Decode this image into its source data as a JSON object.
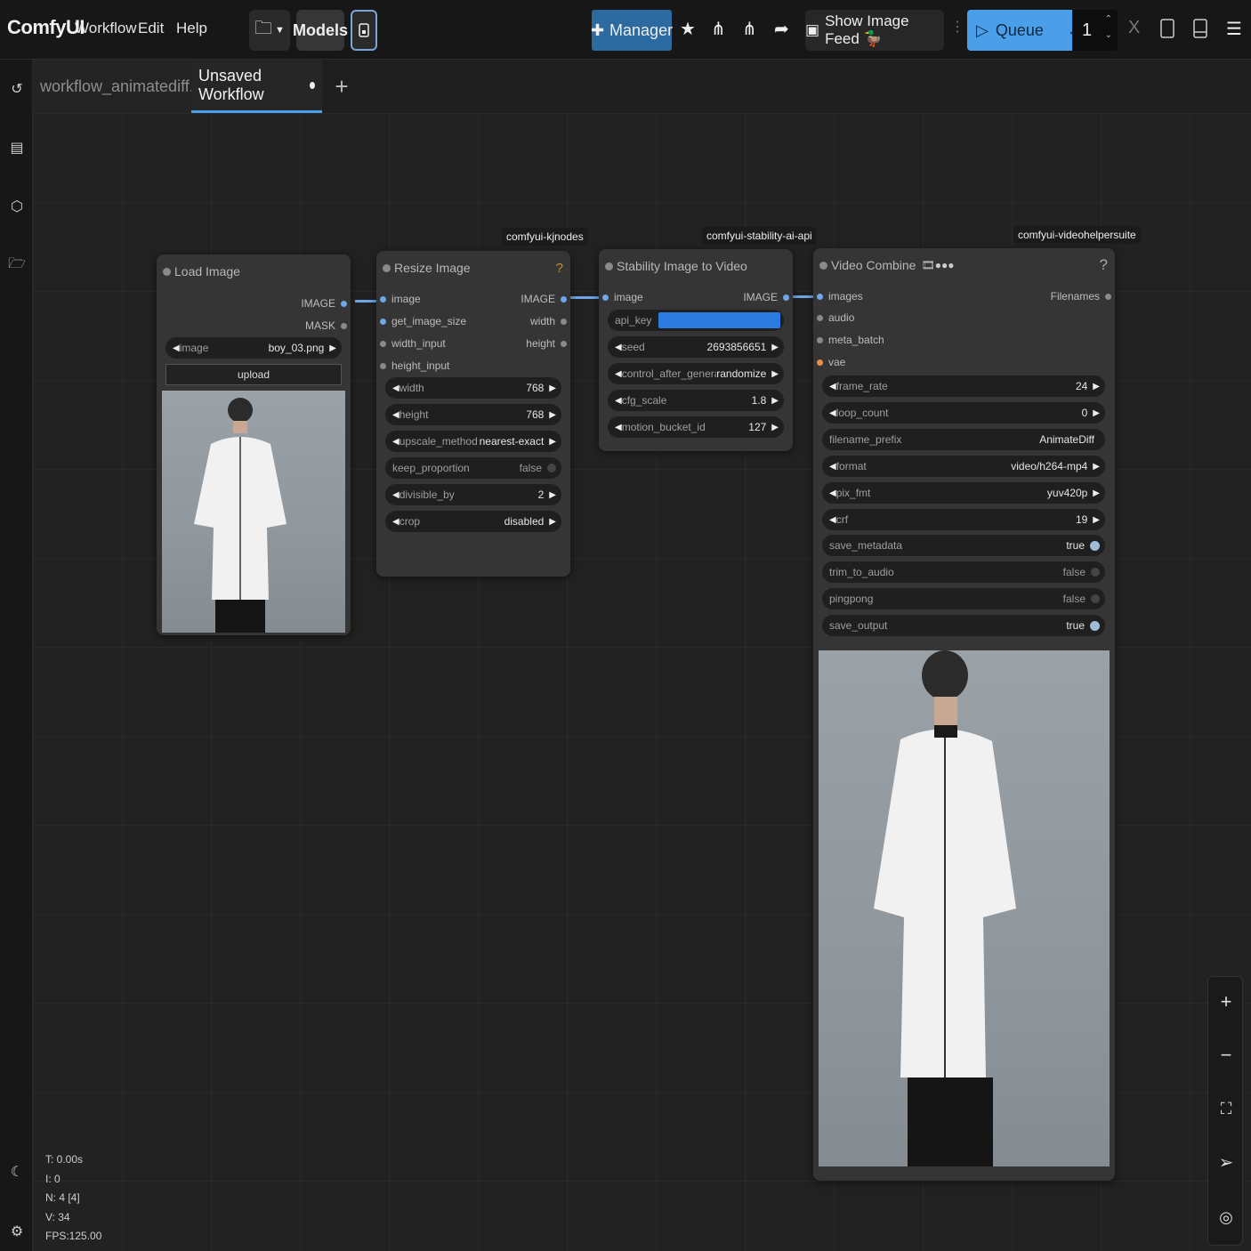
{
  "topbar": {
    "logo": "ComfyUI",
    "menu": [
      "Workflow",
      "Edit",
      "Help"
    ],
    "models_label": "Models",
    "manager_label": "Manager",
    "feed_label": "Show Image Feed 🦆",
    "queue_label": "Queue",
    "queue_count": "1",
    "close_glyph": "X"
  },
  "tabs": [
    {
      "label": "workflow_animatediff..."
    },
    {
      "label": "Unsaved Workflow"
    }
  ],
  "nodes": {
    "load_image": {
      "title": "Load Image",
      "outputs": [
        "IMAGE",
        "MASK"
      ],
      "image_widget": {
        "label": "image",
        "value": "boy_03.png"
      },
      "upload_label": "upload"
    },
    "resize_image": {
      "badge": "comfyui-kjnodes",
      "title": "Resize Image",
      "help": "?",
      "inputs": [
        "image",
        "get_image_size",
        "width_input",
        "height_input"
      ],
      "outputs": [
        "IMAGE",
        "width",
        "height"
      ],
      "widgets": [
        {
          "label": "width",
          "value": "768"
        },
        {
          "label": "height",
          "value": "768"
        },
        {
          "label": "upscale_method",
          "value": "nearest-exact"
        },
        {
          "label": "keep_proportion",
          "value": "false"
        },
        {
          "label": "divisible_by",
          "value": "2"
        },
        {
          "label": "crop",
          "value": "disabled"
        }
      ]
    },
    "stability": {
      "badge": "comfyui-stability-ai-api",
      "title": "Stability Image to Video",
      "inputs": [
        "image"
      ],
      "outputs": [
        "IMAGE"
      ],
      "api_key_label": "api_key",
      "widgets": [
        {
          "label": "seed",
          "value": "2693856651"
        },
        {
          "label": "control_after_generate",
          "value": "randomize"
        },
        {
          "label": "cfg_scale",
          "value": "1.8"
        },
        {
          "label": "motion_bucket_id",
          "value": "127"
        }
      ]
    },
    "video_combine": {
      "badge": "comfyui-videohelpersuite",
      "title": "Video Combine",
      "help": "?",
      "inputs": [
        "images",
        "audio",
        "meta_batch",
        "vae"
      ],
      "outputs": [
        "Filenames"
      ],
      "widgets": [
        {
          "label": "frame_rate",
          "value": "24"
        },
        {
          "label": "loop_count",
          "value": "0"
        },
        {
          "label": "filename_prefix",
          "value": "AnimateDiff"
        },
        {
          "label": "format",
          "value": "video/h264-mp4"
        },
        {
          "label": "pix_fmt",
          "value": "yuv420p"
        },
        {
          "label": "crf",
          "value": "19"
        },
        {
          "label": "save_metadata",
          "value": "true"
        },
        {
          "label": "trim_to_audio",
          "value": "false"
        },
        {
          "label": "pingpong",
          "value": "false"
        },
        {
          "label": "save_output",
          "value": "true"
        }
      ]
    }
  },
  "stats": {
    "t": "T: 0.00s",
    "i": "I: 0",
    "n": "N: 4 [4]",
    "v": "V: 34",
    "fps": "FPS:125.00"
  },
  "colors": {
    "accent": "#4b9ee8",
    "link": "#6fa8e8",
    "node_bg": "#353535"
  }
}
